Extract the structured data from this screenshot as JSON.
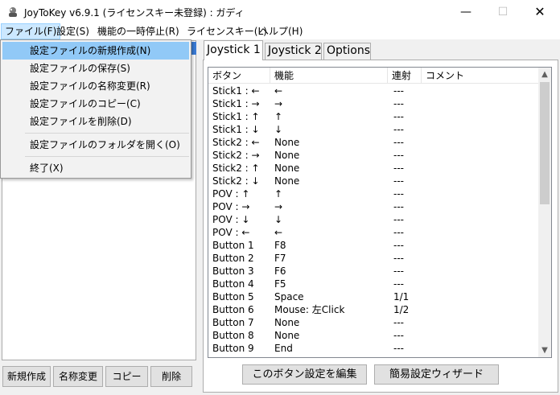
{
  "window": {
    "title": "JoyToKey v6.9.1 (ライセンスキー未登録) : ガディ",
    "minimize": "—",
    "maximize": "☐",
    "close": "✕"
  },
  "menu": [
    "ファイル(F)",
    "設定(S)",
    "機能の一時停止(R)",
    "ライセンスキー(L)",
    "ヘルプ(H)"
  ],
  "file_menu": {
    "items": [
      "設定ファイルの新規作成(N)",
      "設定ファイルの保存(S)",
      "設定ファイルの名称変更(R)",
      "設定ファイルのコピー(C)",
      "設定ファイルを削除(D)",
      "設定ファイルのフォルダを開く(O)",
      "終了(X)"
    ],
    "highlighted_index": 0
  },
  "profile_buttons": [
    "新規作成",
    "名称変更",
    "コピー",
    "削除"
  ],
  "tabs": [
    "Joystick 1",
    "Joystick 2",
    "Options"
  ],
  "active_tab": 0,
  "columns": [
    "ボタン",
    "機能",
    "連射",
    "コメント"
  ],
  "rows": [
    {
      "button": "Stick1 : ←",
      "function": "←",
      "repeat": "---"
    },
    {
      "button": "Stick1 : →",
      "function": "→",
      "repeat": "---"
    },
    {
      "button": "Stick1 : ↑",
      "function": "↑",
      "repeat": "---"
    },
    {
      "button": "Stick1 : ↓",
      "function": "↓",
      "repeat": "---"
    },
    {
      "button": "Stick2 : ←",
      "function": "None",
      "repeat": "---"
    },
    {
      "button": "Stick2 : →",
      "function": "None",
      "repeat": "---"
    },
    {
      "button": "Stick2 : ↑",
      "function": "None",
      "repeat": "---"
    },
    {
      "button": "Stick2 : ↓",
      "function": "None",
      "repeat": "---"
    },
    {
      "button": "POV : ↑",
      "function": "↑",
      "repeat": "---"
    },
    {
      "button": "POV : →",
      "function": "→",
      "repeat": "---"
    },
    {
      "button": "POV : ↓",
      "function": "↓",
      "repeat": "---"
    },
    {
      "button": "POV : ←",
      "function": "←",
      "repeat": "---"
    },
    {
      "button": "Button 1",
      "function": "F8",
      "repeat": "---"
    },
    {
      "button": "Button 2",
      "function": "F7",
      "repeat": "---"
    },
    {
      "button": "Button 3",
      "function": "F6",
      "repeat": "---"
    },
    {
      "button": "Button 4",
      "function": "F5",
      "repeat": "---"
    },
    {
      "button": "Button 5",
      "function": "Space",
      "repeat": "1/1"
    },
    {
      "button": "Button 6",
      "function": "Mouse: 左Click",
      "repeat": "1/2"
    },
    {
      "button": "Button 7",
      "function": "None",
      "repeat": "---"
    },
    {
      "button": "Button 8",
      "function": "None",
      "repeat": "---"
    },
    {
      "button": "Button 9",
      "function": "End",
      "repeat": "---"
    }
  ],
  "scroll_arrows": {
    "up": "▲",
    "down": "▼"
  },
  "action_buttons": [
    "このボタン設定を編集",
    "簡易設定ウィザード"
  ]
}
